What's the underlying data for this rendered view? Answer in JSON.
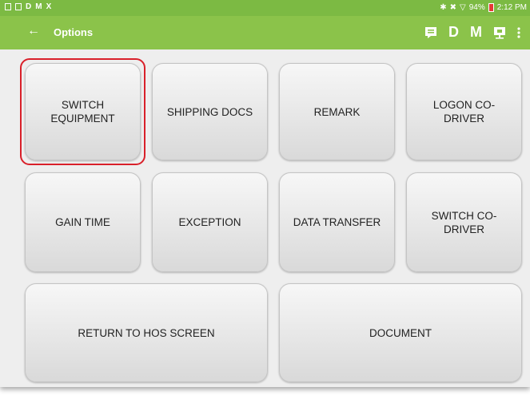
{
  "status_bar": {
    "left_icons": [
      "D",
      "M",
      "X"
    ],
    "battery": "94%",
    "time": "2:12 PM"
  },
  "app_bar": {
    "back_icon": "arrow-left-icon",
    "title": "Options",
    "actions": [
      "message-icon",
      "D",
      "M",
      "monitor-icon",
      "more-vertical-icon"
    ]
  },
  "options": {
    "switch_equipment": "SWITCH EQUIPMENT",
    "shipping_docs": "SHIPPING DOCS",
    "remark": "REMARK",
    "logon_co_driver": "LOGON CO-DRIVER",
    "gain_time": "GAIN TIME",
    "exception": "EXCEPTION",
    "data_transfer": "DATA TRANSFER",
    "switch_co_driver": "SWITCH CO-DRIVER",
    "return_to_hos": "RETURN TO HOS SCREEN",
    "document": "DOCUMENT"
  },
  "highlight_color": "#d9202a",
  "accent_color": "#8bc34a"
}
